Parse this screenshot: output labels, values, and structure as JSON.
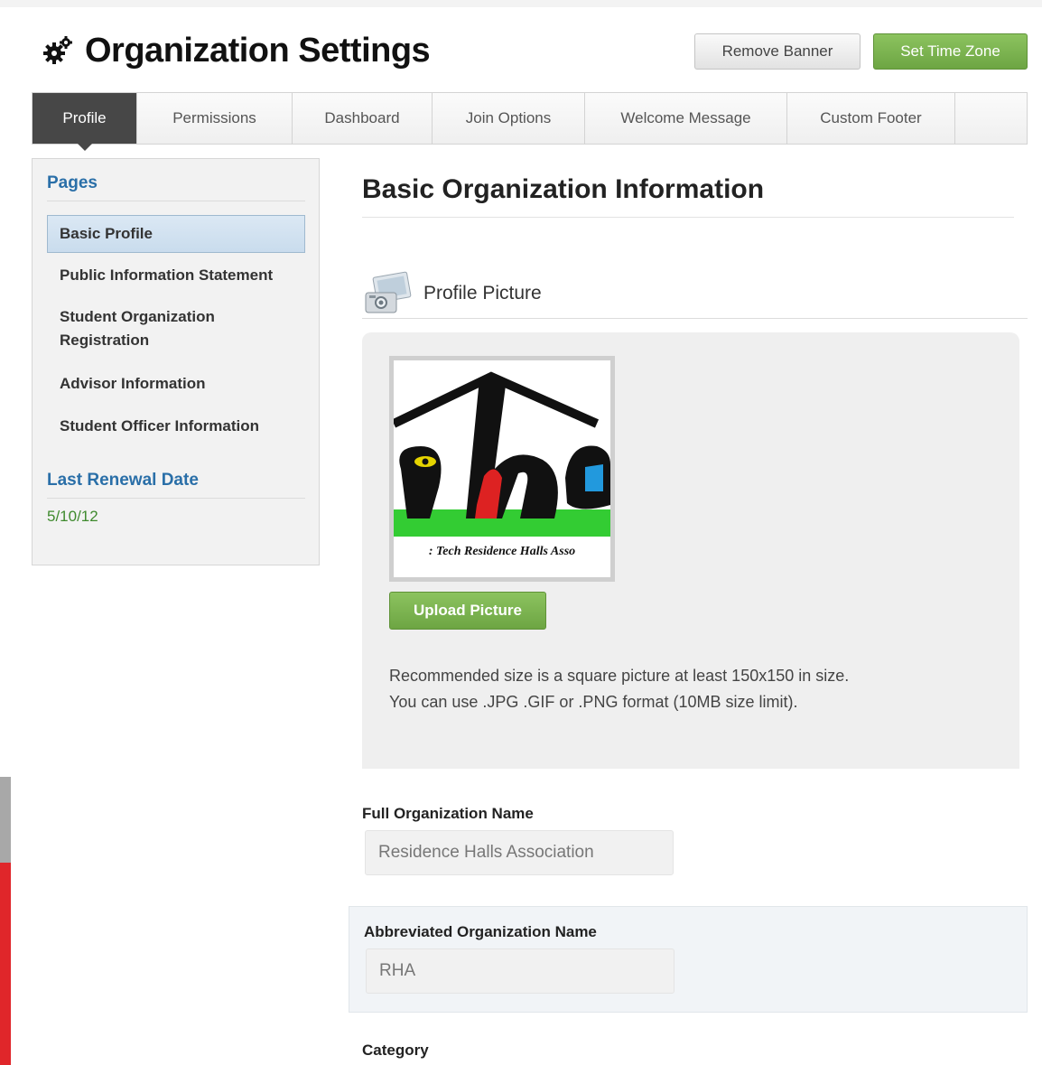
{
  "header": {
    "title": "Organization Settings",
    "buttons": {
      "remove_banner": "Remove Banner",
      "set_time_zone": "Set Time Zone"
    }
  },
  "tabs": [
    {
      "label": "Profile",
      "active": true
    },
    {
      "label": "Permissions"
    },
    {
      "label": "Dashboard"
    },
    {
      "label": "Join Options"
    },
    {
      "label": "Welcome Message"
    },
    {
      "label": "Custom Footer"
    },
    {
      "label": ""
    }
  ],
  "sidebar": {
    "pages_heading": "Pages",
    "items": [
      {
        "label": "Basic Profile",
        "active": true
      },
      {
        "label": "Public Information Statement"
      },
      {
        "label": "Student Organization Registration"
      },
      {
        "label": "Advisor Information"
      },
      {
        "label": "Student Officer Information"
      }
    ],
    "renewal_heading": "Last Renewal Date",
    "renewal_value": "5/10/12"
  },
  "main": {
    "section_title": "Basic Organization Information",
    "profile_picture": {
      "label": "Profile Picture",
      "logo_text": "rha",
      "logo_caption": ": Tech Residence Halls Asso",
      "upload_button": "Upload Picture",
      "help_line1": "Recommended size is a square picture at least 150x150 in size.",
      "help_line2": "You can use .JPG .GIF or .PNG format (10MB size limit)."
    },
    "fields": {
      "full_name_label": "Full Organization Name",
      "full_name_value": "Residence Halls Association",
      "abbrev_label": "Abbreviated Organization Name",
      "abbrev_value": "RHA",
      "category_label": "Category"
    }
  },
  "colors": {
    "accent_green": "#7ab350",
    "link_blue": "#2a6fa8",
    "active_tab": "#474747",
    "renewal_green": "#3f8a2e",
    "background_red": "#e0262a"
  },
  "icons": {
    "title_icon": "gears-icon",
    "profile_picture_icon": "photo-camera-icon"
  }
}
